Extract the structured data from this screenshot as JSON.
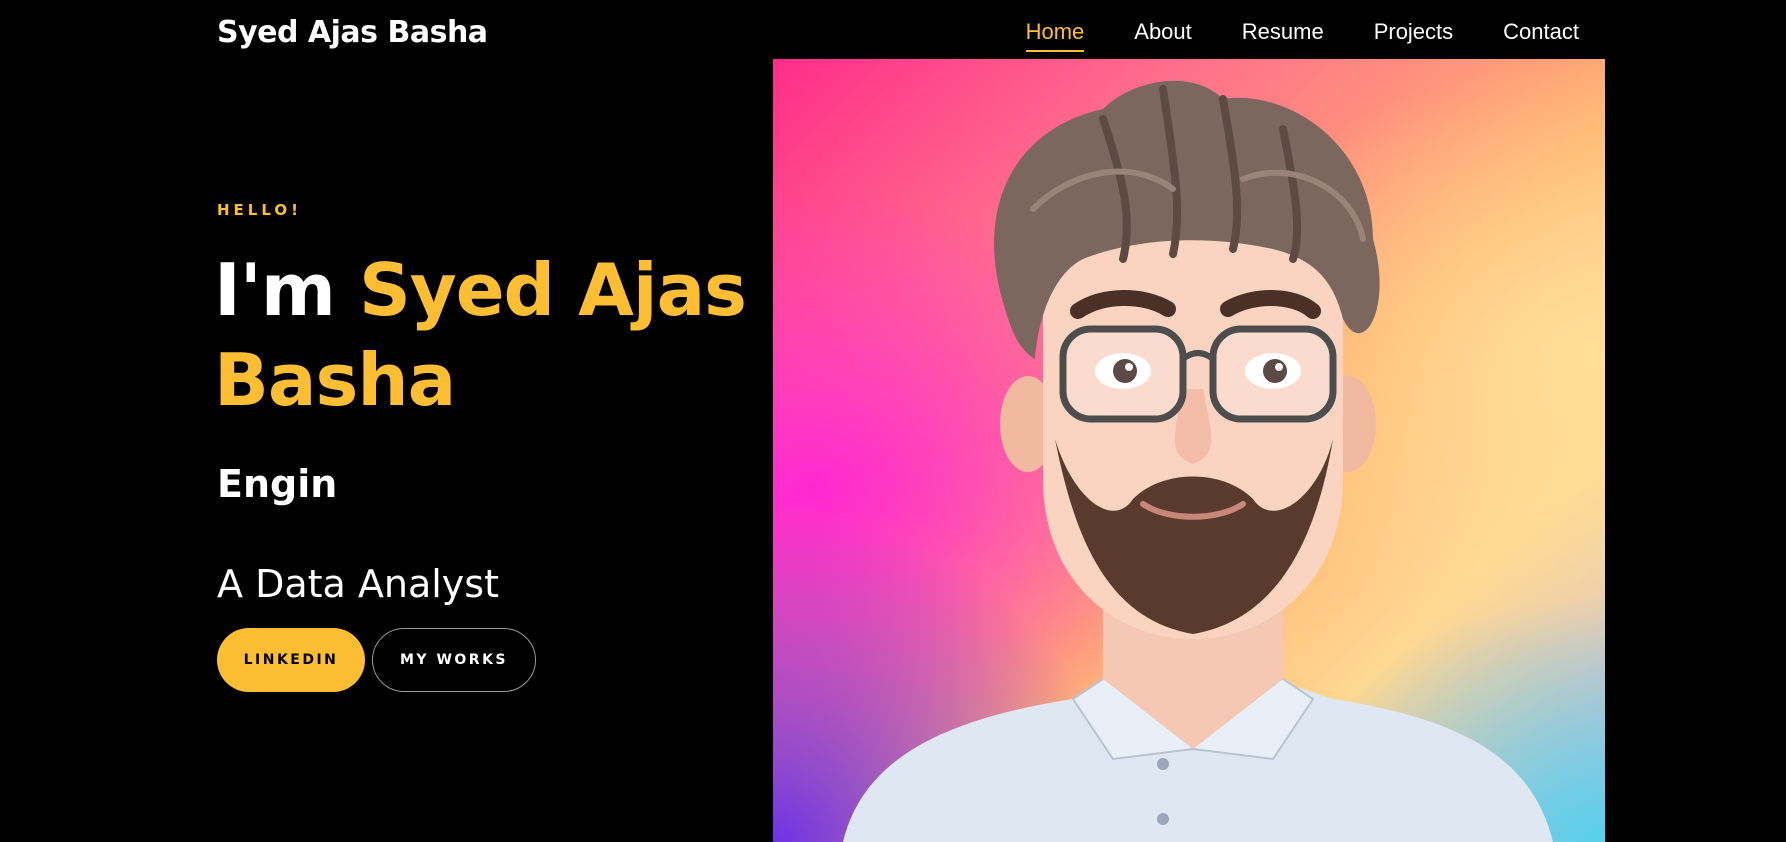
{
  "header": {
    "brand": "Syed Ajas Basha",
    "nav": [
      {
        "label": "Home",
        "active": true
      },
      {
        "label": "About",
        "active": false
      },
      {
        "label": "Resume",
        "active": false
      },
      {
        "label": "Projects",
        "active": false
      },
      {
        "label": "Contact",
        "active": false
      }
    ]
  },
  "hero": {
    "eyebrow": "HELLO!",
    "headline_prefix": "I'm",
    "headline_name": "Syed Ajas Basha",
    "typed_text": "Engin",
    "subtitle": "A Data Analyst",
    "buttons": {
      "primary": "LINKEDIN",
      "secondary": "MY WORKS"
    },
    "portrait_alt": "3D avatar illustration"
  },
  "colors": {
    "background": "#000000",
    "accent": "#fdbe34",
    "text": "#ffffff"
  }
}
